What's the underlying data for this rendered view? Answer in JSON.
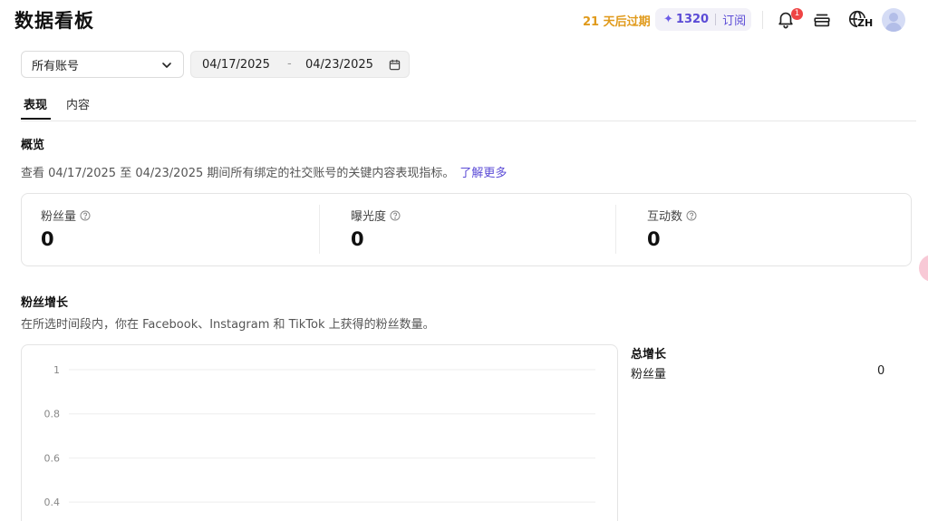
{
  "header": {
    "title": "数据看板",
    "trial_text": "21 天后过期",
    "credits": "1320",
    "subscribe_label": "订阅",
    "notification_count": "1",
    "language": "ZH"
  },
  "filters": {
    "account_select": "所有账号",
    "date_start": "04/17/2025",
    "date_separator": "-",
    "date_end": "04/23/2025"
  },
  "tabs": [
    {
      "label": "表现",
      "active": true
    },
    {
      "label": "内容",
      "active": false
    }
  ],
  "overview": {
    "title": "概览",
    "description": "查看 04/17/2025 至 04/23/2025 期间所有绑定的社交账号的关键内容表现指标。",
    "learn_more": "了解更多",
    "metrics": [
      {
        "label": "粉丝量",
        "value": "0"
      },
      {
        "label": "曝光度",
        "value": "0"
      },
      {
        "label": "互动数",
        "value": "0"
      }
    ]
  },
  "followers_growth": {
    "title": "粉丝增长",
    "description": "在所选时间段内，你在 Facebook、Instagram 和 TikTok 上获得的粉丝数量。",
    "total_title": "总增长",
    "total_rows": [
      {
        "label": "粉丝量",
        "value": "0"
      }
    ]
  },
  "chart_data": {
    "type": "line",
    "y_ticks": [
      "1",
      "0.8",
      "0.6",
      "0.4"
    ],
    "ylim": [
      0,
      1
    ],
    "grid": true,
    "series": []
  }
}
